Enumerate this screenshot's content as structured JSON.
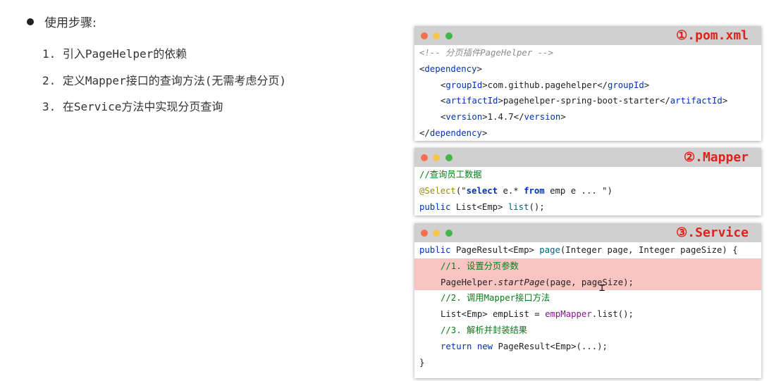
{
  "bullet": {
    "label": "使用步骤:"
  },
  "steps": [
    "1. 引入PageHelper的依赖",
    "2. 定义Mapper接口的查询方法(无需考虑分页)",
    "3. 在Service方法中实现分页查询"
  ],
  "panels": {
    "pom": {
      "title": "①.pom.xml",
      "comment": "<!-- 分页插件PageHelper -->",
      "dep_open_tag": "dependency",
      "group_tag": "groupId",
      "group_val": "com.github.pagehelper",
      "artifact_tag": "artifactId",
      "artifact_val": "pagehelper-spring-boot-starter",
      "version_tag": "version",
      "version_val": "1.4.7"
    },
    "mapper": {
      "title": "②.Mapper",
      "comment": "//查询员工数据",
      "annotation": "@Select",
      "sql_select": "select",
      "sql_mid": " e.* ",
      "sql_from": "from",
      "sql_tail": " emp e ... ",
      "kw_public": "public",
      "ret_type": " List<Emp> ",
      "method": "list",
      "tail": "();"
    },
    "service": {
      "title": "③.Service",
      "sig_public": "public",
      "sig_type": " PageResult<Emp> ",
      "sig_method": "page",
      "sig_params": "(Integer page, Integer pageSize) {",
      "c1": "//1. 设置分页参数",
      "ph_cls": "PageHelper.",
      "ph_method": "startPage",
      "ph_args": "(page, pageSize);",
      "c2": "//2. 调用Mapper接口方法",
      "list_decl": "List<Emp> empList = ",
      "list_field": "empMapper",
      "list_call": ".list();",
      "c3": "//3. 解析并封装结果",
      "ret_kw": "return",
      "ret_new": "new",
      "ret_tail": " PageResult<Emp>(...);",
      "close": "}"
    }
  },
  "colors": {
    "title_red": "#e0221b",
    "highlight": "#f9c4c1",
    "bar_gray": "#d0d0d0"
  }
}
